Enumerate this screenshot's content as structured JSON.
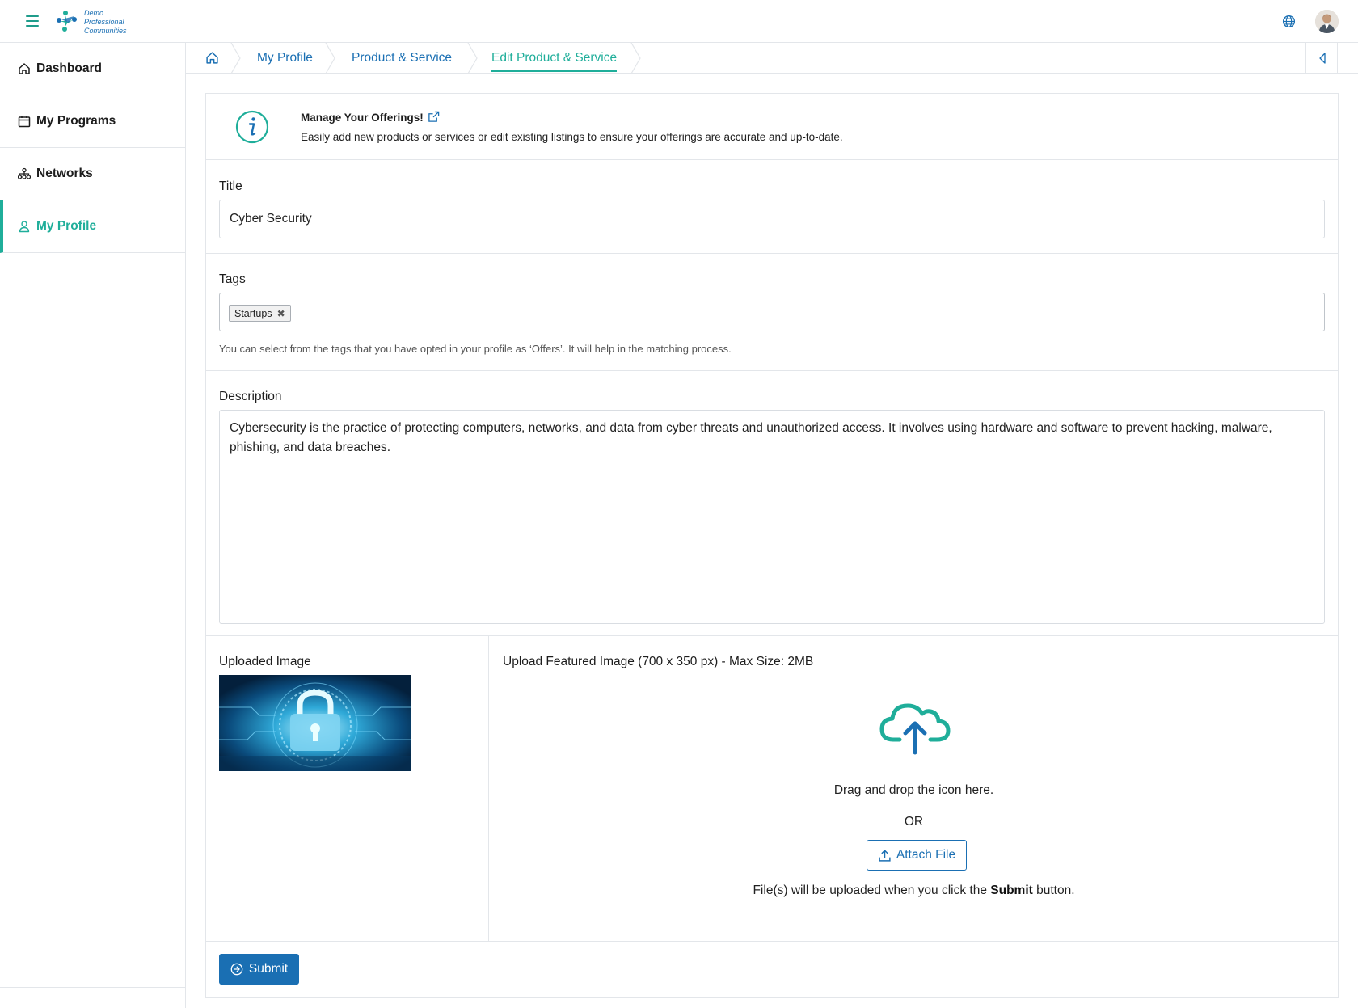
{
  "header": {
    "logo_lines": [
      "Demo",
      "Professional",
      "Communities"
    ],
    "icons": {
      "menu": "hamburger-icon",
      "language": "globe-icon",
      "user": "avatar"
    }
  },
  "sidebar": {
    "items": [
      {
        "label": "Dashboard",
        "icon": "home-icon",
        "active": false
      },
      {
        "label": "My Programs",
        "icon": "calendar-icon",
        "active": false
      },
      {
        "label": "Networks",
        "icon": "network-icon",
        "active": false
      },
      {
        "label": "My Profile",
        "icon": "user-icon",
        "active": true
      }
    ]
  },
  "breadcrumb": {
    "items": [
      "My Profile",
      "Product & Service",
      "Edit Product & Service"
    ],
    "current": "Edit Product & Service"
  },
  "info": {
    "title": "Manage Your Offerings!",
    "description": "Easily add new products or services or edit existing listings to ensure your offerings are accurate and up-to-date."
  },
  "form": {
    "title_label": "Title",
    "title_value": "Cyber Security",
    "tags_label": "Tags",
    "tags": [
      "Startups"
    ],
    "tags_help": "You can select from the tags that you have opted in your profile as ‘Offers’. It will help in the matching process.",
    "description_label": "Description",
    "description_value": "Cybersecurity is the practice of protecting computers, networks, and data from cyber threats and unauthorized access. It involves using hardware and software to prevent hacking, malware, phishing, and data breaches."
  },
  "upload": {
    "uploaded_label": "Uploaded Image",
    "featured_label": "Upload Featured Image (700 x 350 px) - Max Size: 2MB",
    "drag_text": "Drag and drop the icon here.",
    "or_text": "OR",
    "attach_label": "Attach File",
    "note_prefix": "File(s) will be uploaded when you click the",
    "note_bold": "Submit",
    "note_suffix": "button."
  },
  "submit_label": "Submit",
  "colors": {
    "primary": "#1a6fb3",
    "accent": "#1fae9a",
    "border": "#e3e6ea"
  }
}
